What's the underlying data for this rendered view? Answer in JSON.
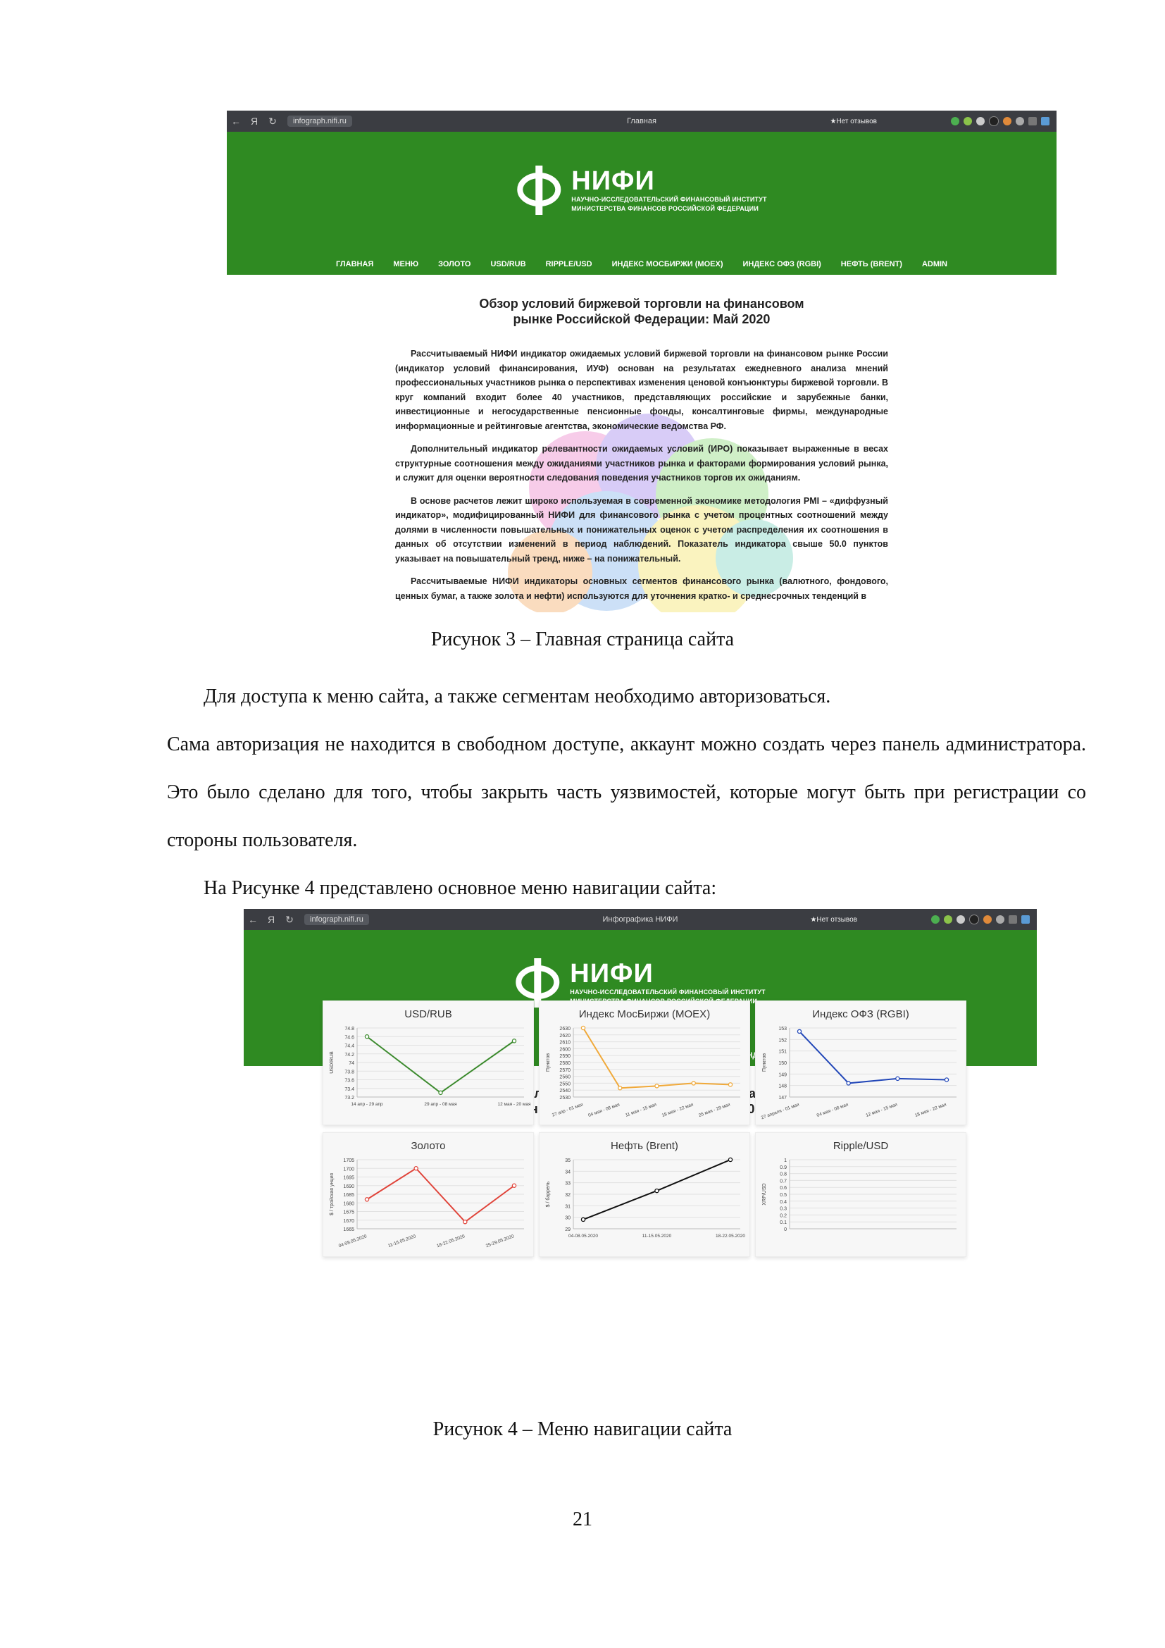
{
  "browser1": {
    "url": "infograph.nifi.ru",
    "tab_title": "Главная",
    "reviews": "★Нет отзывов"
  },
  "browser2": {
    "url": "infograph.nifi.ru",
    "tab_title": "Инфографика НИФИ",
    "reviews": "★Нет отзывов"
  },
  "site": {
    "logo_name": "НИФИ",
    "logo_sub_1": "НАУЧНО-ИССЛЕДОВАТЕЛЬСКИЙ ФИНАНСОВЫЙ ИНСТИТУТ",
    "logo_sub_2": "МИНИСТЕРСТВА ФИНАНСОВ РОССИЙСКОЙ ФЕДЕРАЦИИ",
    "menu": [
      "ГЛАВНАЯ",
      "МЕНЮ",
      "ЗОЛОТО",
      "USD/RUB",
      "RIPPLE/USD",
      "ИНДЕКС МОСБИРЖИ (MOEX)",
      "ИНДЕКС ОФЗ (RGBI)",
      "НЕФТЬ (BRENT)",
      "ADMIN"
    ],
    "page_title": "Обзор условий биржевой торговли на финансовом\nрынке Российской Федерации: Май 2020"
  },
  "article": {
    "p1": "Рассчитываемый НИФИ индикатор ожидаемых условий биржевой торговли на финансовом рынке России (индикатор условий финансирования, ИУФ) основан на результатах ежедневного анализа мнений профессиональных участников рынка о перспективах изменения ценовой конъюнктуры биржевой торговли. В круг компаний входит более 40 участников, представляющих российские и зарубежные банки, инвестиционные и негосударственные пенсионные фонды, консалтинговые фирмы, международные информационные и рейтинговые агентства, экономические ведомства РФ.",
    "p2": "Дополнительный индикатор релевантности ожидаемых условий (ИРО) показывает выраженные в весах структурные соотношения между ожиданиями участников рынка и факторами формирования условий рынка, и служит для оценки вероятности следования поведения участников торгов их ожиданиям.",
    "p3": "В основе расчетов лежит широко используемая в современной экономике методология PMI – «диффузный индикатор», модифицированный НИФИ для финансового рынка с учетом процентных соотношений между долями в численности повышательных и понижательных оценок с учетом распределения их соотношения в данных об отсутствии изменений в период наблюдений. Показатель индикатора свыше 50.0 пунктов указывает на повышательный тренд, ниже – на понижательный.",
    "p4": "Рассчитываемые НИФИ индикаторы основных сегментов финансового рынка (валютного, фондового, ценных бумаг, а также золота и нефти) используются для уточнения кратко- и среднесрочных тенденций в"
  },
  "document": {
    "caption3": "Рисунок 3 – Главная страница сайта",
    "para1_line1": "Для доступа к меню сайта, а также сегментам необходимо авторизоваться.",
    "para1_rest": "Сама авторизация не находится в свободном доступе, аккаунт можно создать через панель администратора. Это было сделано для того, чтобы закрыть часть уязвимостей, которые могут быть при регистрации со стороны пользователя.",
    "para2": "На Рисунке 4 представлено основное меню навигации сайта:",
    "caption4": "Рисунок 4 – Меню навигации сайта",
    "page_number": "21"
  },
  "colors": {
    "header_green": "#2f8a22",
    "usd": "#3d8b2f",
    "moex": "#f0a93a",
    "rgbi": "#2247b8",
    "gold": "#e0443a",
    "brent": "#111111"
  },
  "chart_data": [
    {
      "type": "line",
      "title": "USD/RUB",
      "ylabel": "USD/RUB",
      "x": [
        "14 апр - 29 апр",
        "29 апр - 08 мая",
        "12 мая - 20 мая"
      ],
      "y": [
        74.6,
        73.3,
        74.5
      ],
      "ylim": [
        73.2,
        74.8
      ],
      "yticks": [
        74.8,
        74.6,
        74.4,
        74.2,
        74.0,
        73.8,
        73.6,
        73.4,
        73.2
      ],
      "color": "#3d8b2f"
    },
    {
      "type": "line",
      "title": "Индекс МосБиржи (MOEX)",
      "ylabel": "Пунктов",
      "x": [
        "27 апр - 01 мая",
        "04 мая - 08 мая",
        "11 мая - 15 мая",
        "18 мая - 22 мая",
        "25 мая - 29 мая"
      ],
      "y": [
        2630,
        2543,
        2546,
        2550,
        2548
      ],
      "ylim": [
        2530,
        2630
      ],
      "yticks": [
        2630,
        2620,
        2610,
        2600,
        2590,
        2580,
        2570,
        2560,
        2550,
        2540,
        2530
      ],
      "color": "#f0a93a"
    },
    {
      "type": "line",
      "title": "Индекс ОФЗ (RGBI)",
      "ylabel": "Пунктов",
      "x": [
        "27 апреля - 01 мая",
        "04 мая - 08 мая",
        "12 мая - 15 мая",
        "18 мая - 22 мая"
      ],
      "y": [
        152.7,
        148.2,
        148.6,
        148.5
      ],
      "ylim": [
        147,
        153
      ],
      "yticks": [
        153,
        152,
        151,
        150,
        149,
        148,
        147
      ],
      "color": "#2247b8"
    },
    {
      "type": "line",
      "title": "Золото",
      "ylabel": "$ / тройская унция",
      "x": [
        "04-08.05.2020",
        "11-15.05.2020",
        "18-22.05.2020",
        "25-29.05.2020"
      ],
      "y": [
        1682,
        1700,
        1669,
        1690
      ],
      "ylim": [
        1665,
        1705
      ],
      "yticks": [
        1705,
        1700,
        1695,
        1690,
        1685,
        1680,
        1675,
        1670,
        1665
      ],
      "color": "#e0443a"
    },
    {
      "type": "line",
      "title": "Нефть (Brent)",
      "ylabel": "$ / баррель",
      "x": [
        "04-08.05.2020",
        "11-15.05.2020",
        "18-22.05.2020"
      ],
      "y": [
        29.8,
        32.3,
        35
      ],
      "ylim": [
        29,
        35
      ],
      "yticks": [
        35,
        34,
        33,
        32,
        31,
        30,
        29
      ],
      "color": "#111111"
    },
    {
      "type": "line",
      "title": "Ripple/USD",
      "ylabel": "XRP/USD",
      "x": [],
      "y": [],
      "ylim": [
        0,
        1.0
      ],
      "yticks": [
        1.0,
        0.9,
        0.8,
        0.7,
        0.6,
        0.5,
        0.4,
        0.3,
        0.2,
        0.1,
        0
      ],
      "color": "#999999"
    }
  ]
}
